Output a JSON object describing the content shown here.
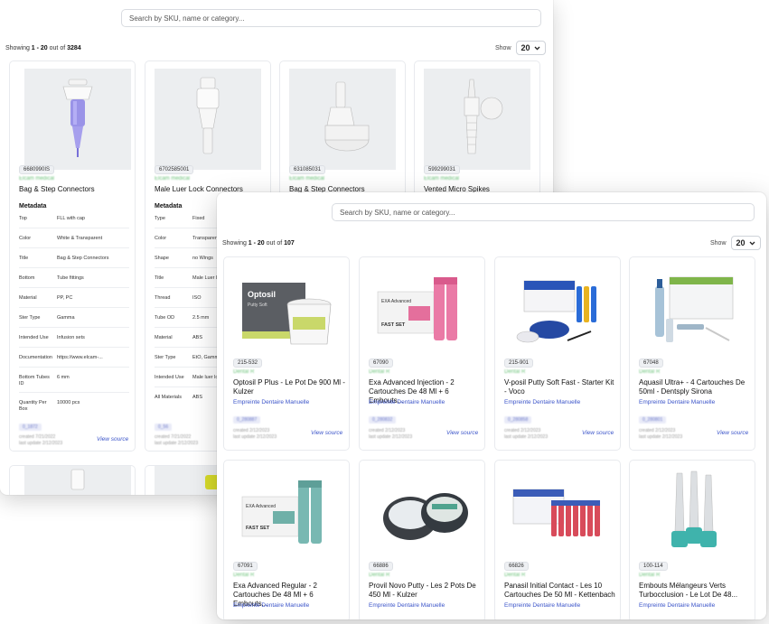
{
  "back": {
    "search_placeholder": "Search by SKU, name or category...",
    "summary": {
      "prefix": "Showing ",
      "range": "1 - 20",
      "mid": " out of ",
      "total": "3284"
    },
    "show_label": "Show",
    "show_value": "20",
    "cards": [
      {
        "sku": "6680990IS",
        "brand": "Elcam medical",
        "name": "Bag & Step Connectors",
        "meta_title": "Metadata",
        "meta": [
          [
            "Top",
            "FLL with cap"
          ],
          [
            "Color",
            "White & Transparent"
          ],
          [
            "Title",
            "Bag & Step Connectors"
          ],
          [
            "Bottom",
            "Tube fittings"
          ],
          [
            "Material",
            "PP, PC"
          ],
          [
            "Ster Type",
            "Gamma"
          ],
          [
            "Intended Use",
            "Infusion sets"
          ],
          [
            "Documentation",
            "https://www.elcam-..."
          ],
          [
            "Bottom Tubes ID",
            "6 mm"
          ],
          [
            "Quantity Per Box",
            "10000 pcs"
          ]
        ],
        "id": "0_1872",
        "created": "created 7/21/2022",
        "updated": "last update 2/12/2023",
        "view": "View source"
      },
      {
        "sku": "6702585001",
        "brand": "Elcam medical",
        "name": "Male Luer Lock Connectors",
        "meta_title": "Metadata",
        "meta": [
          [
            "Type",
            "Fixed"
          ],
          [
            "Color",
            "Transparent"
          ],
          [
            "Shape",
            "no Wings"
          ],
          [
            "Title",
            "Male Luer Lo"
          ],
          [
            "Thread",
            "ISO"
          ],
          [
            "Tube OD",
            "2.5 mm"
          ],
          [
            "Material",
            "ABS"
          ],
          [
            "Ster Type",
            "EtO, Gamma"
          ],
          [
            "Intended Use",
            "Male luer loc"
          ],
          [
            "All Materials",
            "ABS"
          ]
        ],
        "id": "0_56",
        "created": "created 7/21/2022",
        "updated": "last update 2/12/2023"
      },
      {
        "sku": "631085031",
        "brand": "Elcam medical",
        "name": "Bag & Step Connectors"
      },
      {
        "sku": "599299031",
        "brand": "Elcam medical",
        "name": "Vented Micro Spikes"
      }
    ]
  },
  "front": {
    "search_placeholder": "Search by SKU, name or category...",
    "summary": {
      "prefix": "Showing ",
      "range": "1 - 20",
      "mid": " out of ",
      "total": "107"
    },
    "show_label": "Show",
    "show_value": "20",
    "cards": [
      {
        "sku": "215-532",
        "brand": "Dental R",
        "name": "Optosil P Plus - Le Pot De 900 Ml - Kulzer",
        "category": "Empreinte Dentaire Manuelle",
        "id": "0_280887",
        "created": "created 2/12/2023",
        "updated": "last update 2/12/2023",
        "view": "View source"
      },
      {
        "sku": "67090",
        "brand": "Dental R",
        "name": "Exa Advanced Injection - 2 Cartouches De 48 Ml + 6 Embouts...",
        "category": "Empreinte Dentaire Manuelle",
        "id": "0_280832",
        "created": "created 2/12/2023",
        "updated": "last update 2/12/2023",
        "view": "View source"
      },
      {
        "sku": "215-901",
        "brand": "Dental R",
        "name": "V-posil Putty Soft Fast - Starter Kit - Voco",
        "category": "Empreinte Dentaire Manuelle",
        "id": "0_280858",
        "created": "created 2/12/2023",
        "updated": "last update 2/12/2023",
        "view": "View source"
      },
      {
        "sku": "67048",
        "brand": "Dental R",
        "name": "Aquasil Ultra+ - 4 Cartouches De 50ml - Dentsply Sirona",
        "category": "Empreinte Dentaire Manuelle",
        "id": "0_280801",
        "created": "created 2/12/2023",
        "updated": "last update 2/12/2023",
        "view": "View source"
      },
      {
        "sku": "67091",
        "brand": "Dental R",
        "name": "Exa Advanced Regular - 2 Cartouches De 48 Ml + 6 Embouts...",
        "category": "Empreinte Dentaire Manuelle"
      },
      {
        "sku": "66886",
        "brand": "Dental R",
        "name": "Provil Novo Putty - Les 2 Pots De 450 Ml - Kulzer",
        "category": "Empreinte Dentaire Manuelle"
      },
      {
        "sku": "66826",
        "brand": "Dental R",
        "name": "Panasil Initial Contact - Les 10 Cartouches De 50 Ml - Kettenbach",
        "category": "Empreinte Dentaire Manuelle"
      },
      {
        "sku": "100-114",
        "brand": "Dental R",
        "name": "Embouts Mélangeurs Verts Turbocclusion - Le Lot De 48...",
        "category": "Empreinte Dentaire Manuelle"
      }
    ],
    "product_text": {
      "optosil_name": "Optosil",
      "optosil_sub": "Putty Soft",
      "exa_name": "EXA Advanced",
      "fast_set": "FAST SET"
    }
  },
  "colors": {
    "link": "#3b54c9",
    "brand_green": "#6cc27a",
    "border": "#e8eaee"
  }
}
